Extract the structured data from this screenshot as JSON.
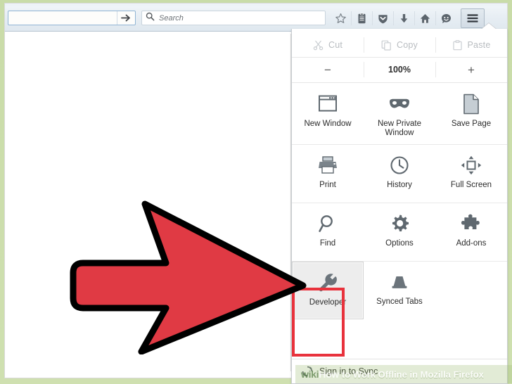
{
  "browser": {
    "name": "Mozilla Firefox",
    "urlbar": {
      "value": "",
      "placeholder": ""
    },
    "search": {
      "value": "",
      "placeholder": "Search"
    },
    "go_button_label": "Go",
    "toolbar_icons": [
      {
        "name": "bookmark-star-icon",
        "label": "Bookmark this page"
      },
      {
        "name": "reading-list-icon",
        "label": "Reading List"
      },
      {
        "name": "pocket-icon",
        "label": "Save to Pocket"
      },
      {
        "name": "downloads-icon",
        "label": "Downloads"
      },
      {
        "name": "home-icon",
        "label": "Home"
      },
      {
        "name": "hello-icon",
        "label": "Firefox Hello"
      },
      {
        "name": "hamburger-menu-icon",
        "label": "Open menu"
      }
    ]
  },
  "menu_panel": {
    "edit_row": [
      {
        "label": "Cut",
        "icon": "scissors-icon",
        "disabled": true
      },
      {
        "label": "Copy",
        "icon": "copy-icon",
        "disabled": true
      },
      {
        "label": "Paste",
        "icon": "paste-icon",
        "disabled": true
      }
    ],
    "zoom_row": {
      "minus_label": "−",
      "level": "100%",
      "plus_label": "+"
    },
    "grid": [
      [
        {
          "label": "New Window",
          "icon": "new-window-icon",
          "active": false
        },
        {
          "label": "New Private Window",
          "icon": "mask-icon",
          "active": false
        },
        {
          "label": "Save Page",
          "icon": "page-icon",
          "active": false
        }
      ],
      [
        {
          "label": "Print",
          "icon": "printer-icon",
          "active": false
        },
        {
          "label": "History",
          "icon": "clock-icon",
          "active": false
        },
        {
          "label": "Full Screen",
          "icon": "fullscreen-icon",
          "active": false
        }
      ],
      [
        {
          "label": "Find",
          "icon": "magnifier-icon",
          "active": false
        },
        {
          "label": "Options",
          "icon": "gear-icon",
          "active": false
        },
        {
          "label": "Add-ons",
          "icon": "puzzle-icon",
          "active": false
        }
      ],
      [
        {
          "label": "Developer",
          "icon": "wrench-icon",
          "active": true
        },
        {
          "label": "Synced Tabs",
          "icon": "synced-tabs-icon",
          "active": false
        },
        {
          "label": "",
          "icon": "",
          "active": false
        }
      ]
    ],
    "footer": {
      "label": "Sign in to Sync",
      "icon": "sync-icon"
    }
  },
  "annotation": {
    "arrow": {
      "name": "red-pointer-arrow",
      "direction": "right",
      "points_to": "Developer"
    },
    "highlight_box_color": "#e8323c"
  },
  "watermark": {
    "logo_wiki": "wiki",
    "logo_how": "How",
    "text": "to Work Offline in Mozilla Firefox"
  },
  "colors": {
    "accent_red": "#e8323c",
    "arrow_fill": "#e03a44",
    "arrow_stroke": "#000000",
    "frame_green": "#c9dca8",
    "panel_bg": "#ffffff",
    "icon_gray": "#6a737b"
  }
}
